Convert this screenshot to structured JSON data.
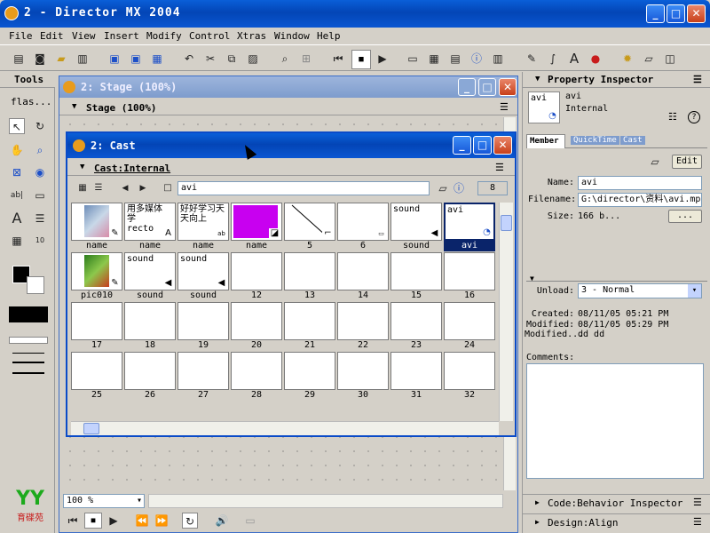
{
  "app": {
    "title": "2 - Director MX 2004"
  },
  "menu": [
    "File",
    "Edit",
    "View",
    "Insert",
    "Modify",
    "Control",
    "Xtras",
    "Window",
    "Help"
  ],
  "tools": {
    "title": "Tools",
    "dropdown": "flas..."
  },
  "stage": {
    "title": "2: Stage (100%)",
    "subtitle": "Stage (100%)",
    "zoom": "100 %"
  },
  "cast": {
    "title": "2: Cast",
    "header": "Cast:Internal",
    "name_field": "avi",
    "number": "8",
    "cells": [
      {
        "id": "pic",
        "text": "",
        "label": "name",
        "badge": "brush-icon"
      },
      {
        "id": "t1",
        "text": "用多媒体\n学\nrecto",
        "label": "name",
        "badge": "text-icon"
      },
      {
        "id": "t2",
        "text": "好好学习天\n天向上",
        "label": "name",
        "badge": "field-icon"
      },
      {
        "id": "mag",
        "text": "",
        "label": "name",
        "badge": "shape-icon"
      },
      {
        "id": "line",
        "text": "",
        "label": "5",
        "badge": "vector-icon"
      },
      {
        "id": "e6",
        "text": "",
        "label": "6",
        "badge": "bitmap-icon"
      },
      {
        "id": "snd",
        "text": "sound",
        "label": "sound",
        "badge": "sound-icon"
      },
      {
        "id": "avi",
        "text": "avi",
        "label": "avi",
        "badge": "video-icon",
        "selected": true
      },
      {
        "id": "pic10",
        "text": "",
        "label": "pic010",
        "badge": "brush-icon"
      },
      {
        "id": "s1",
        "text": "sound",
        "label": "sound",
        "badge": "sound-icon"
      },
      {
        "id": "s2",
        "text": "sound",
        "label": "sound",
        "badge": "sound-icon"
      },
      {
        "label": "12"
      },
      {
        "label": "13"
      },
      {
        "label": "14"
      },
      {
        "label": "15"
      },
      {
        "label": "16"
      },
      {
        "label": "17"
      },
      {
        "label": "18"
      },
      {
        "label": "19"
      },
      {
        "label": "20"
      },
      {
        "label": "21"
      },
      {
        "label": "22"
      },
      {
        "label": "23"
      },
      {
        "label": "24"
      },
      {
        "label": "25"
      },
      {
        "label": "26"
      },
      {
        "label": "27"
      },
      {
        "label": "28"
      },
      {
        "label": "29"
      },
      {
        "label": "30"
      },
      {
        "label": "31"
      },
      {
        "label": "32"
      }
    ]
  },
  "pi": {
    "title": "Property Inspector",
    "thumb_text": "avi",
    "member_name": "avi",
    "member_cast": "Internal",
    "tabs": [
      "Member",
      "QuickTime",
      "Cast"
    ],
    "edit_label": "Edit",
    "name_label": "Name:",
    "name_value": "avi",
    "filename_label": "Filename:",
    "filename_value": "G:\\director\\资料\\avi.mpg",
    "size_label": "Size:",
    "size_value": "166 b...",
    "browse_label": "...",
    "unload_label": "Unload:",
    "unload_value": "3 - Normal",
    "created_label": "Created:",
    "created_value": "08/11/05 05:21 PM",
    "modified_label": "Modified:",
    "modified_value": "08/11/05 05:29 PM",
    "modifiedby_label": "Modified...",
    "modifiedby_value": "dd dd",
    "comments_label": "Comments:",
    "bottom1": "Code:Behavior Inspector",
    "bottom2": "Design:Align"
  },
  "logo": "育碟苑",
  "colors": {
    "accent": "#0a246a",
    "magenta": "#c800f0"
  }
}
